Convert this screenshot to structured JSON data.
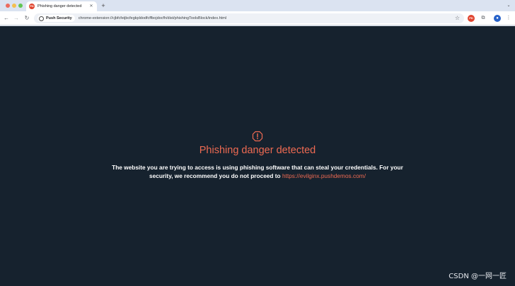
{
  "tab": {
    "title": "Phishing danger detected",
    "favicon": "PD"
  },
  "toolbar": {
    "site_chip": "Push Security",
    "url": "chrome-extension://cjbfcfeijbcfegkpldodfcffbojdocfh/dist/phishingToolsBlock/index.html",
    "ext_badge": "PD",
    "profile_initial": "●"
  },
  "page": {
    "heading": "Phishing danger detected",
    "message": "The website you are trying to access is using phishing software that can steal your credentials. For your security, we recommend you do not proceed to ",
    "link": "https://evilginx.pushdemos.com/"
  },
  "watermark": "CSDN @一网一匠",
  "colors": {
    "page_bg": "#16222e",
    "accent": "#ee6a52"
  },
  "icons": [
    "back-icon",
    "forward-icon",
    "reload-icon",
    "star-icon",
    "puzzle-icon",
    "menu-icon",
    "warning-icon"
  ]
}
